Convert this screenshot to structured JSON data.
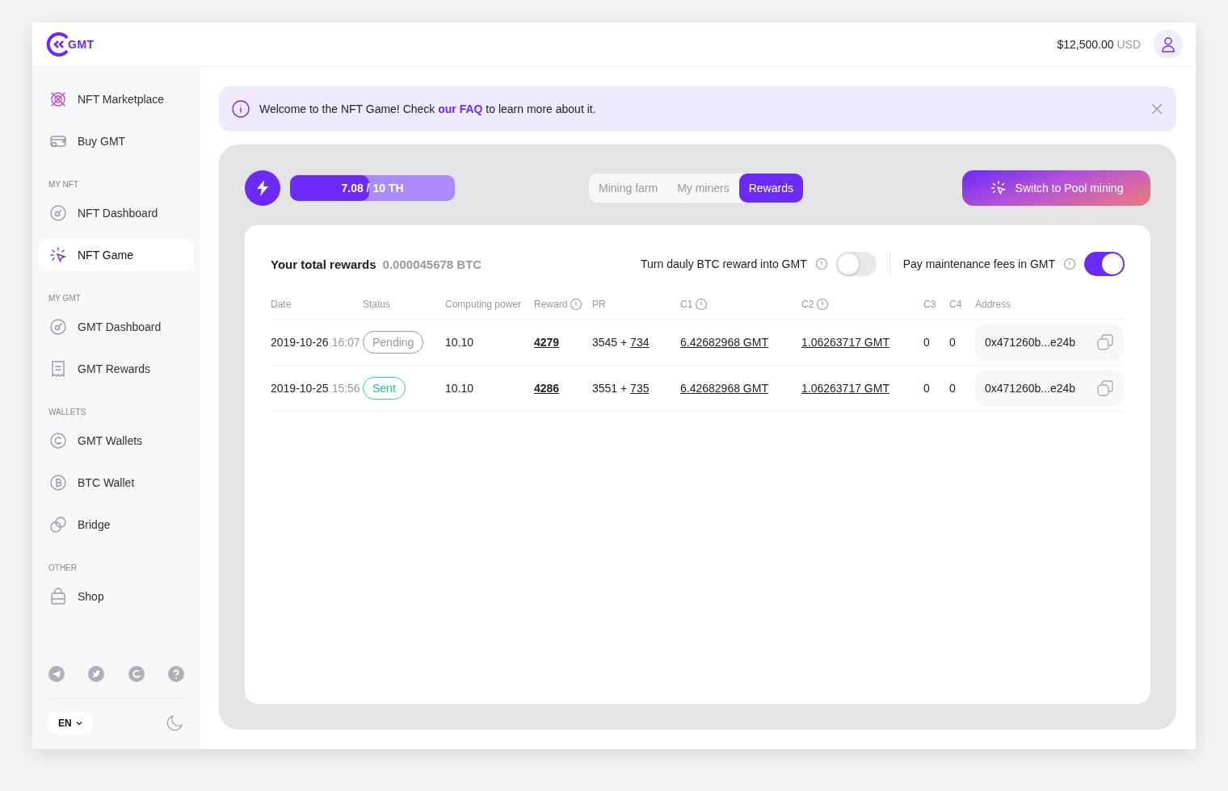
{
  "logo": {
    "text": "GMT"
  },
  "header": {
    "balance": "$12,500.00",
    "currency": "USD"
  },
  "sidebar": {
    "groups": [
      {
        "items": [
          {
            "label": "NFT Marketplace",
            "kind": "marketplace",
            "selected": false
          },
          {
            "label": "Buy GMT",
            "kind": "card",
            "selected": false
          }
        ]
      },
      {
        "heading": "MY NFT",
        "items": [
          {
            "label": "NFT Dashboard",
            "kind": "gauge",
            "selected": false
          },
          {
            "label": "NFT Game",
            "kind": "cursor",
            "selected": true
          }
        ]
      },
      {
        "heading": "MY GMT",
        "items": [
          {
            "label": "GMT Dashboard",
            "kind": "gauge",
            "selected": false
          },
          {
            "label": "GMT Rewards",
            "kind": "receipt",
            "selected": false
          }
        ]
      },
      {
        "heading": "WALLETS",
        "items": [
          {
            "label": "GMT Wallets",
            "kind": "coin-g",
            "selected": false
          },
          {
            "label": "BTC Wallet",
            "kind": "coin-b",
            "selected": false
          },
          {
            "label": "Bridge",
            "kind": "bridge",
            "selected": false
          }
        ]
      },
      {
        "heading": "OTHER",
        "items": [
          {
            "label": "Shop",
            "kind": "bag",
            "selected": false
          }
        ]
      }
    ],
    "language": "EN"
  },
  "banner": {
    "text_before": "Welcome to the NFT Game! Check",
    "link": "our FAQ",
    "text_after": "to learn more about it."
  },
  "mining": {
    "capacity": {
      "text": "7.08 / 10 TH",
      "level": 0.48
    },
    "tabs": [
      {
        "label": "Mining farm",
        "selected": false
      },
      {
        "label": "My miners",
        "selected": false
      },
      {
        "label": "Rewards",
        "selected": true
      }
    ],
    "pool_button": "Switch to Pool mining"
  },
  "rewards": {
    "title": "Your total rewards",
    "total": "0.000045678 BTC",
    "toggles": [
      {
        "label": "Turn dauly BTC reward into GMT",
        "on": false
      },
      {
        "label": "Pay maintenance fees in GMT",
        "on": true
      }
    ],
    "columns": [
      {
        "label": "Date",
        "info": false
      },
      {
        "label": "Status",
        "info": false
      },
      {
        "label": "Computing power",
        "info": false
      },
      {
        "label": "Reward",
        "info": true
      },
      {
        "label": "PR",
        "info": false
      },
      {
        "label": "C1",
        "info": true
      },
      {
        "label": "C2",
        "info": true
      },
      {
        "label": "C3",
        "info": false
      },
      {
        "label": "C4",
        "info": false
      },
      {
        "label": "Address",
        "info": false
      }
    ],
    "rows": [
      {
        "date": "2019-10-26",
        "time": "16:07",
        "status": {
          "label": "Pending",
          "kind": "pending"
        },
        "power": "10.10",
        "reward": "4279",
        "pr_base": "3545 +",
        "pr_bonus": "734",
        "c1": "6.42682968 GMT",
        "c2": "1.06263717 GMT",
        "c3": "0",
        "c4": "0",
        "address": "0x471260b...e24b"
      },
      {
        "date": "2019-10-25",
        "time": "15:56",
        "status": {
          "label": "Sent",
          "kind": "sent"
        },
        "power": "10.10",
        "reward": "4286",
        "pr_base": "3551 +",
        "pr_bonus": "735",
        "c1": "6.42682968 GMT",
        "c2": "1.06263717 GMT",
        "c3": "0",
        "c4": "0",
        "address": "0x471260b...e24b"
      }
    ]
  }
}
